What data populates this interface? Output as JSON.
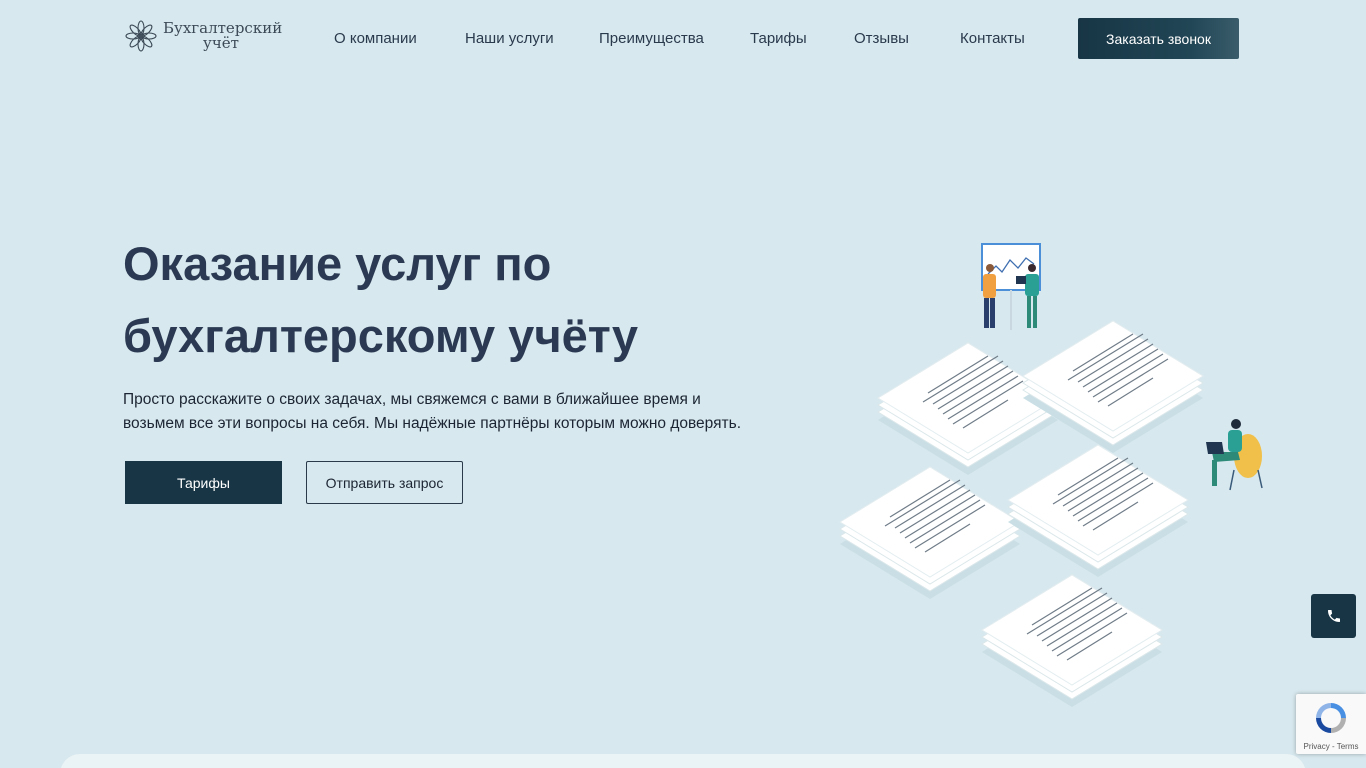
{
  "brand": {
    "name_line1": "Бухгалтерский",
    "name_line2": "учёт",
    "icon": "flower-logo-icon"
  },
  "nav": {
    "items": [
      {
        "label": "О компании"
      },
      {
        "label": "Наши услуги"
      },
      {
        "label": "Преимущества"
      },
      {
        "label": "Тарифы"
      },
      {
        "label": "Отзывы"
      },
      {
        "label": "Контакты"
      }
    ],
    "cta_label": "Заказать звонок"
  },
  "hero": {
    "title_line1": "Оказание услуг по",
    "title_line2": "бухгалтерскому учёту",
    "subtitle_line1": "Просто расскажите о своих задачах, мы свяжемся с вами в ближайшее время и",
    "subtitle_line2": "возьмем все эти вопросы на себя. Мы надёжные партнёры которым можно доверять.",
    "primary_button": "Тарифы",
    "secondary_button": "Отправить запрос"
  },
  "widgets": {
    "phone_icon": "phone-icon",
    "recaptcha_links": "Privacy - Terms"
  },
  "colors": {
    "background": "#d7e8ee",
    "accent": "#173545",
    "title": "#2b3a52"
  }
}
